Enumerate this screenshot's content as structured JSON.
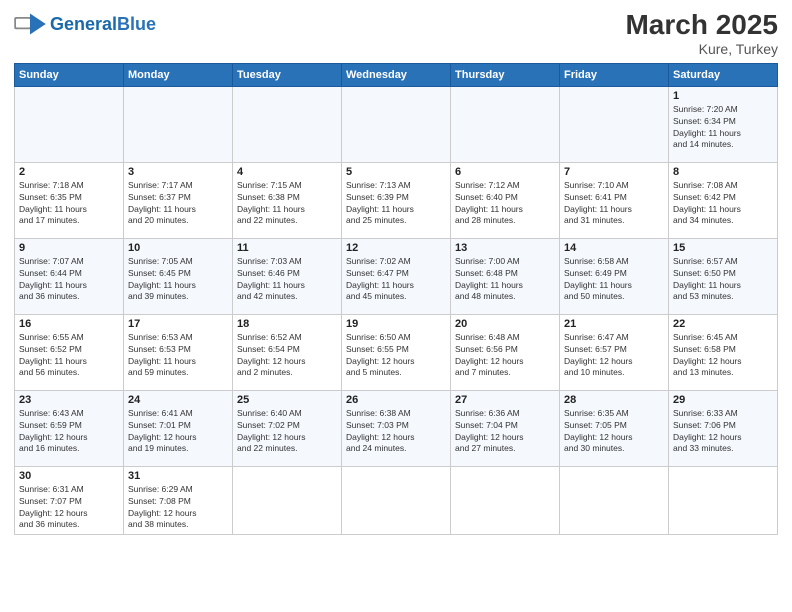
{
  "header": {
    "logo_general": "General",
    "logo_blue": "Blue",
    "title": "March 2025",
    "subtitle": "Kure, Turkey"
  },
  "days_of_week": [
    "Sunday",
    "Monday",
    "Tuesday",
    "Wednesday",
    "Thursday",
    "Friday",
    "Saturday"
  ],
  "weeks": [
    [
      {
        "day": "",
        "info": ""
      },
      {
        "day": "",
        "info": ""
      },
      {
        "day": "",
        "info": ""
      },
      {
        "day": "",
        "info": ""
      },
      {
        "day": "",
        "info": ""
      },
      {
        "day": "",
        "info": ""
      },
      {
        "day": "1",
        "info": "Sunrise: 7:20 AM\nSunset: 6:34 PM\nDaylight: 11 hours\nand 14 minutes."
      }
    ],
    [
      {
        "day": "2",
        "info": "Sunrise: 7:18 AM\nSunset: 6:35 PM\nDaylight: 11 hours\nand 17 minutes."
      },
      {
        "day": "3",
        "info": "Sunrise: 7:17 AM\nSunset: 6:37 PM\nDaylight: 11 hours\nand 20 minutes."
      },
      {
        "day": "4",
        "info": "Sunrise: 7:15 AM\nSunset: 6:38 PM\nDaylight: 11 hours\nand 22 minutes."
      },
      {
        "day": "5",
        "info": "Sunrise: 7:13 AM\nSunset: 6:39 PM\nDaylight: 11 hours\nand 25 minutes."
      },
      {
        "day": "6",
        "info": "Sunrise: 7:12 AM\nSunset: 6:40 PM\nDaylight: 11 hours\nand 28 minutes."
      },
      {
        "day": "7",
        "info": "Sunrise: 7:10 AM\nSunset: 6:41 PM\nDaylight: 11 hours\nand 31 minutes."
      },
      {
        "day": "8",
        "info": "Sunrise: 7:08 AM\nSunset: 6:42 PM\nDaylight: 11 hours\nand 34 minutes."
      }
    ],
    [
      {
        "day": "9",
        "info": "Sunrise: 7:07 AM\nSunset: 6:44 PM\nDaylight: 11 hours\nand 36 minutes."
      },
      {
        "day": "10",
        "info": "Sunrise: 7:05 AM\nSunset: 6:45 PM\nDaylight: 11 hours\nand 39 minutes."
      },
      {
        "day": "11",
        "info": "Sunrise: 7:03 AM\nSunset: 6:46 PM\nDaylight: 11 hours\nand 42 minutes."
      },
      {
        "day": "12",
        "info": "Sunrise: 7:02 AM\nSunset: 6:47 PM\nDaylight: 11 hours\nand 45 minutes."
      },
      {
        "day": "13",
        "info": "Sunrise: 7:00 AM\nSunset: 6:48 PM\nDaylight: 11 hours\nand 48 minutes."
      },
      {
        "day": "14",
        "info": "Sunrise: 6:58 AM\nSunset: 6:49 PM\nDaylight: 11 hours\nand 50 minutes."
      },
      {
        "day": "15",
        "info": "Sunrise: 6:57 AM\nSunset: 6:50 PM\nDaylight: 11 hours\nand 53 minutes."
      }
    ],
    [
      {
        "day": "16",
        "info": "Sunrise: 6:55 AM\nSunset: 6:52 PM\nDaylight: 11 hours\nand 56 minutes."
      },
      {
        "day": "17",
        "info": "Sunrise: 6:53 AM\nSunset: 6:53 PM\nDaylight: 11 hours\nand 59 minutes."
      },
      {
        "day": "18",
        "info": "Sunrise: 6:52 AM\nSunset: 6:54 PM\nDaylight: 12 hours\nand 2 minutes."
      },
      {
        "day": "19",
        "info": "Sunrise: 6:50 AM\nSunset: 6:55 PM\nDaylight: 12 hours\nand 5 minutes."
      },
      {
        "day": "20",
        "info": "Sunrise: 6:48 AM\nSunset: 6:56 PM\nDaylight: 12 hours\nand 7 minutes."
      },
      {
        "day": "21",
        "info": "Sunrise: 6:47 AM\nSunset: 6:57 PM\nDaylight: 12 hours\nand 10 minutes."
      },
      {
        "day": "22",
        "info": "Sunrise: 6:45 AM\nSunset: 6:58 PM\nDaylight: 12 hours\nand 13 minutes."
      }
    ],
    [
      {
        "day": "23",
        "info": "Sunrise: 6:43 AM\nSunset: 6:59 PM\nDaylight: 12 hours\nand 16 minutes."
      },
      {
        "day": "24",
        "info": "Sunrise: 6:41 AM\nSunset: 7:01 PM\nDaylight: 12 hours\nand 19 minutes."
      },
      {
        "day": "25",
        "info": "Sunrise: 6:40 AM\nSunset: 7:02 PM\nDaylight: 12 hours\nand 22 minutes."
      },
      {
        "day": "26",
        "info": "Sunrise: 6:38 AM\nSunset: 7:03 PM\nDaylight: 12 hours\nand 24 minutes."
      },
      {
        "day": "27",
        "info": "Sunrise: 6:36 AM\nSunset: 7:04 PM\nDaylight: 12 hours\nand 27 minutes."
      },
      {
        "day": "28",
        "info": "Sunrise: 6:35 AM\nSunset: 7:05 PM\nDaylight: 12 hours\nand 30 minutes."
      },
      {
        "day": "29",
        "info": "Sunrise: 6:33 AM\nSunset: 7:06 PM\nDaylight: 12 hours\nand 33 minutes."
      }
    ],
    [
      {
        "day": "30",
        "info": "Sunrise: 6:31 AM\nSunset: 7:07 PM\nDaylight: 12 hours\nand 36 minutes."
      },
      {
        "day": "31",
        "info": "Sunrise: 6:29 AM\nSunset: 7:08 PM\nDaylight: 12 hours\nand 38 minutes."
      },
      {
        "day": "",
        "info": ""
      },
      {
        "day": "",
        "info": ""
      },
      {
        "day": "",
        "info": ""
      },
      {
        "day": "",
        "info": ""
      },
      {
        "day": "",
        "info": ""
      }
    ]
  ]
}
